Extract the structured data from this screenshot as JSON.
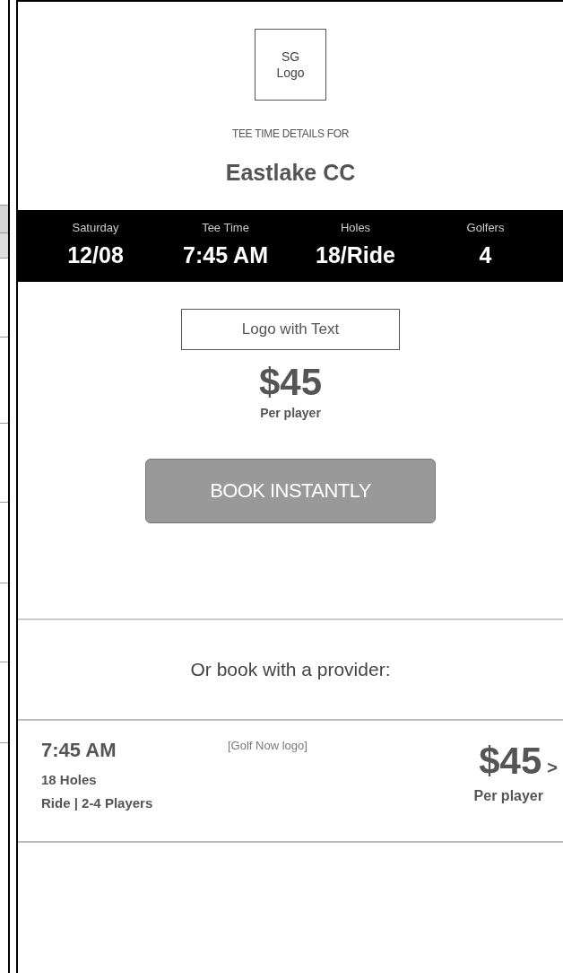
{
  "logo": "SG Logo",
  "heading": "TEE TIME DETAILS FOR",
  "course": "Eastlake CC",
  "details": [
    {
      "label": "Saturday",
      "value": "12/08"
    },
    {
      "label": "Tee Time",
      "value": "7:45 AM"
    },
    {
      "label": "Holes",
      "value": "18/Ride"
    },
    {
      "label": "Golfers",
      "value": "4"
    }
  ],
  "partner_logo": "Logo with Text",
  "price": "$45",
  "price_note": "Per player",
  "book_button": "BOOK INSTANTLY",
  "provider_heading": "Or book with a provider:",
  "providers": [
    {
      "time": "7:45 AM",
      "holes": "18 Holes",
      "info": "Ride | 2-4 Players",
      "logo": "[Golf Now logo]",
      "price": "$45",
      "chevron": ">",
      "price_note": "Per player"
    }
  ]
}
